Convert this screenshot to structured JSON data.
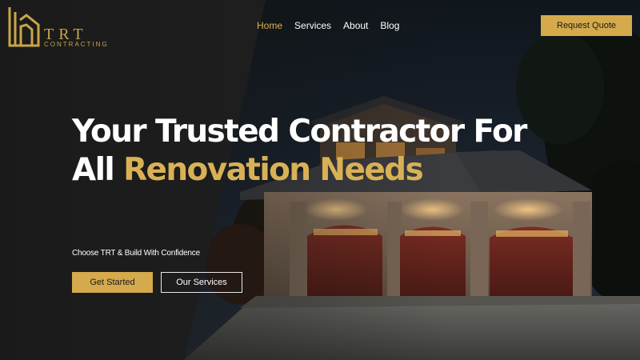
{
  "brand": {
    "title": "TRT",
    "subtitle": "CONTRACTING",
    "accent_color": "#d4aa4c"
  },
  "nav": {
    "items": [
      {
        "label": "Home",
        "active": true
      },
      {
        "label": "Services",
        "active": false
      },
      {
        "label": "About",
        "active": false
      },
      {
        "label": "Blog",
        "active": false
      }
    ]
  },
  "header": {
    "cta_label": "Request Quote"
  },
  "hero": {
    "headline_line1": "Your Trusted Contractor For",
    "headline_line2_plain": "All ",
    "headline_line2_accent": "Renovation Needs",
    "tagline": "Choose TRT & Build With Confidence",
    "primary_button": "Get Started",
    "secondary_button": "Our Services"
  },
  "colors": {
    "dark_panel": "#222222",
    "accent": "#d4aa4c",
    "text": "#ffffff"
  }
}
